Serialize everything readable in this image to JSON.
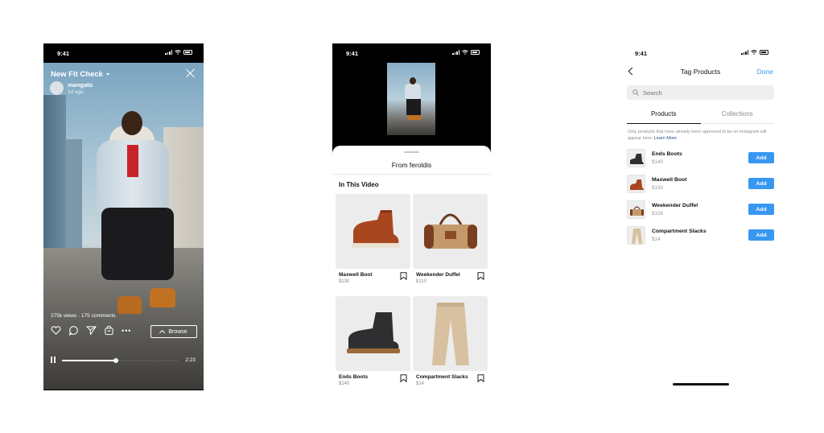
{
  "video_screen": {
    "status_time": "9:41",
    "title": "New Fit Check",
    "username": "mangato",
    "time_ago": "1d ago",
    "stats": "275k views · 175 comments",
    "browse_label": "Browse",
    "duration": "2:23",
    "progress": 0.46
  },
  "shop_screen": {
    "status_time": "9:41",
    "sheet_title": "From feroldis",
    "section_title": "In This Video",
    "products": [
      {
        "name": "Maxwell Boot",
        "price": "$130"
      },
      {
        "name": "Weekender Duffel",
        "price": "$110"
      },
      {
        "name": "Ends Boots",
        "price": "$140"
      },
      {
        "name": "Compartment Slacks",
        "price": "$14"
      }
    ]
  },
  "tag_screen": {
    "status_time": "9:41",
    "title": "Tag Products",
    "done_label": "Done",
    "search_placeholder": "Search",
    "tabs": [
      "Products",
      "Collections"
    ],
    "note": "Only products that have already been approved to be on Instagram will appear here.",
    "learn_more": "Learn More",
    "add_label": "Add",
    "products": [
      {
        "name": "Ends Boots",
        "price": "$140"
      },
      {
        "name": "Maxwell Boot",
        "price": "$130"
      },
      {
        "name": "Weekender Duffel",
        "price": "$158"
      },
      {
        "name": "Compartment Slacks",
        "price": "$14"
      }
    ]
  },
  "colors": {
    "accent_blue": "#3897f0",
    "boot_brown": "#a8461f",
    "boot_black": "#2f2f31",
    "duffel_tan": "#c49a6c",
    "slacks_beige": "#d8c1a0"
  }
}
